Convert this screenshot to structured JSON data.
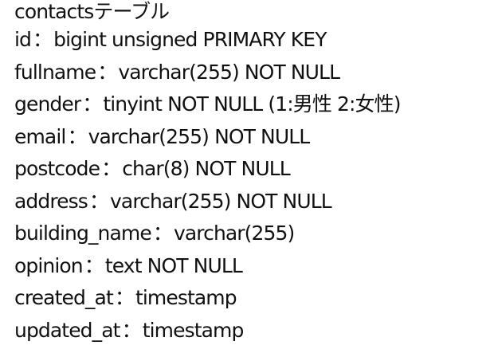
{
  "document": {
    "title": "contactsテーブル",
    "separator": "：",
    "fields": [
      {
        "name": "id",
        "definition": "bigint unsigned PRIMARY KEY"
      },
      {
        "name": "fullname",
        "definition": "varchar(255) NOT NULL"
      },
      {
        "name": "gender",
        "definition": "tinyint NOT NULL (1:男性 2:女性)"
      },
      {
        "name": "email",
        "definition": "varchar(255) NOT NULL"
      },
      {
        "name": "postcode",
        "definition": "char(8) NOT NULL"
      },
      {
        "name": "address",
        "definition": "varchar(255) NOT NULL"
      },
      {
        "name": "building_name",
        "definition": "varchar(255)"
      },
      {
        "name": "opinion",
        "definition": "text NOT NULL"
      },
      {
        "name": "created_at",
        "definition": "timestamp"
      },
      {
        "name": "updated_at",
        "definition": "timestamp"
      }
    ]
  }
}
